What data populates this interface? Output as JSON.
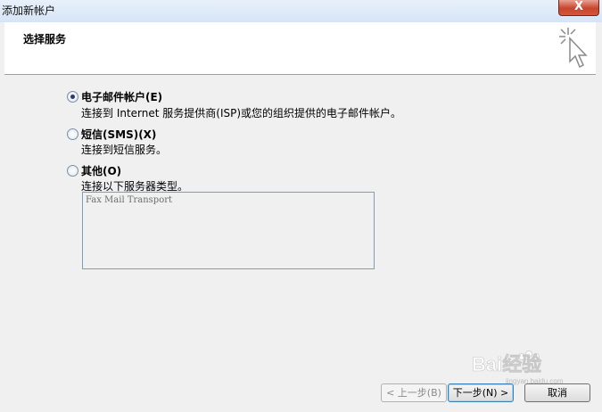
{
  "window": {
    "title": "添加新帐户",
    "close_symbol": "X"
  },
  "header": {
    "title": "选择服务"
  },
  "options": [
    {
      "label": "电子邮件帐户(E)",
      "description": "连接到 Internet 服务提供商(ISP)或您的组织提供的电子邮件帐户。",
      "checked": true
    },
    {
      "label": "短信(SMS)(X)",
      "description": "连接到短信服务。",
      "checked": false
    },
    {
      "label": "其他(O)",
      "description": "连接以下服务器类型。",
      "checked": false
    }
  ],
  "other_servers": {
    "items": [
      "Fax Mail Transport"
    ]
  },
  "buttons": {
    "back": "< 上一步(B)",
    "next": "下一步(N) >",
    "cancel": "取消"
  },
  "watermark": {
    "text": "Bai经验",
    "sub": "jingyan.baidu.com"
  }
}
